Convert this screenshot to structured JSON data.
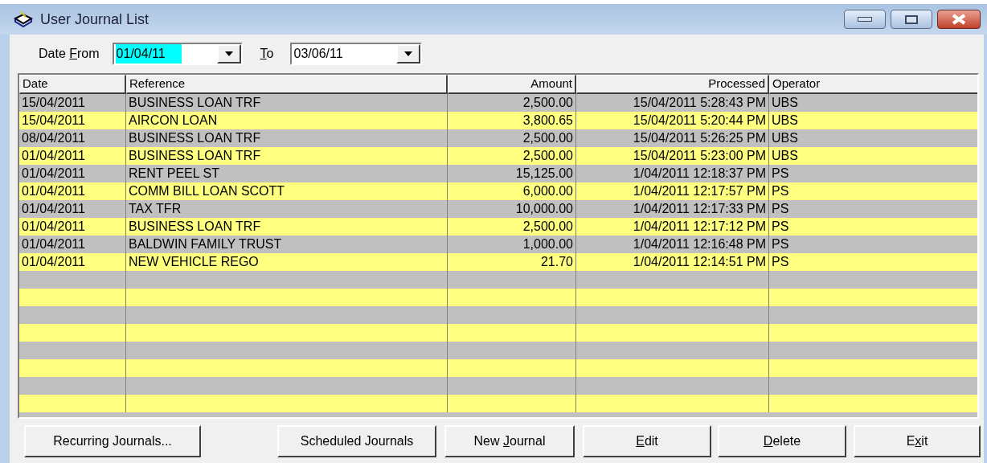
{
  "window": {
    "title": "User Journal List"
  },
  "filter": {
    "from": {
      "label_before": "Date ",
      "access_key": "F",
      "label_after": "rom",
      "value": "01/04/11",
      "focused": true
    },
    "to": {
      "access_key": "T",
      "label_after": "o",
      "value": "03/06/11",
      "focused": false
    }
  },
  "table": {
    "columns": [
      {
        "label": "Date",
        "kind": "text"
      },
      {
        "label": "Reference",
        "kind": "text"
      },
      {
        "label": "Amount",
        "kind": "number"
      },
      {
        "label": "Processed",
        "kind": "number"
      },
      {
        "label": "Operator",
        "kind": "text"
      }
    ],
    "rows": [
      [
        "15/04/2011",
        "BUSINESS LOAN TRF",
        "2,500.00",
        "15/04/2011 5:28:43 PM",
        "UBS"
      ],
      [
        "15/04/2011",
        "AIRCON LOAN",
        "3,800.65",
        "15/04/2011 5:20:44 PM",
        "UBS"
      ],
      [
        "08/04/2011",
        "BUSINESS LOAN TRF",
        "2,500.00",
        "15/04/2011 5:26:25 PM",
        "UBS"
      ],
      [
        "01/04/2011",
        "BUSINESS LOAN TRF",
        "2,500.00",
        "15/04/2011 5:23:00 PM",
        "UBS"
      ],
      [
        "01/04/2011",
        "RENT PEEL ST",
        "15,125.00",
        "1/04/2011 12:18:37 PM",
        "PS"
      ],
      [
        "01/04/2011",
        "COMM BILL LOAN SCOTT",
        "6,000.00",
        "1/04/2011 12:17:57 PM",
        "PS"
      ],
      [
        "01/04/2011",
        "TAX TFR",
        "10,000.00",
        "1/04/2011 12:17:33 PM",
        "PS"
      ],
      [
        "01/04/2011",
        "BUSINESS LOAN TRF",
        "2,500.00",
        "1/04/2011 12:17:12 PM",
        "PS"
      ],
      [
        "01/04/2011",
        "BALDWIN FAMILY TRUST",
        "1,000.00",
        "1/04/2011 12:16:48 PM",
        "PS"
      ],
      [
        "01/04/2011",
        "NEW VEHICLE REGO",
        "21.70",
        "1/04/2011 12:14:51 PM",
        "PS"
      ]
    ]
  },
  "buttons": [
    {
      "label_before": "Recurring Journals..."
    },
    {
      "label_before": "Scheduled Journals"
    },
    {
      "label_before": "New ",
      "access_key": "J",
      "label_after": "ournal"
    },
    {
      "access_key": "E",
      "label_after": "dit"
    },
    {
      "access_key": "D",
      "label_after": "elete"
    },
    {
      "label_before": "E",
      "access_key": "x",
      "label_after": "it"
    }
  ]
}
